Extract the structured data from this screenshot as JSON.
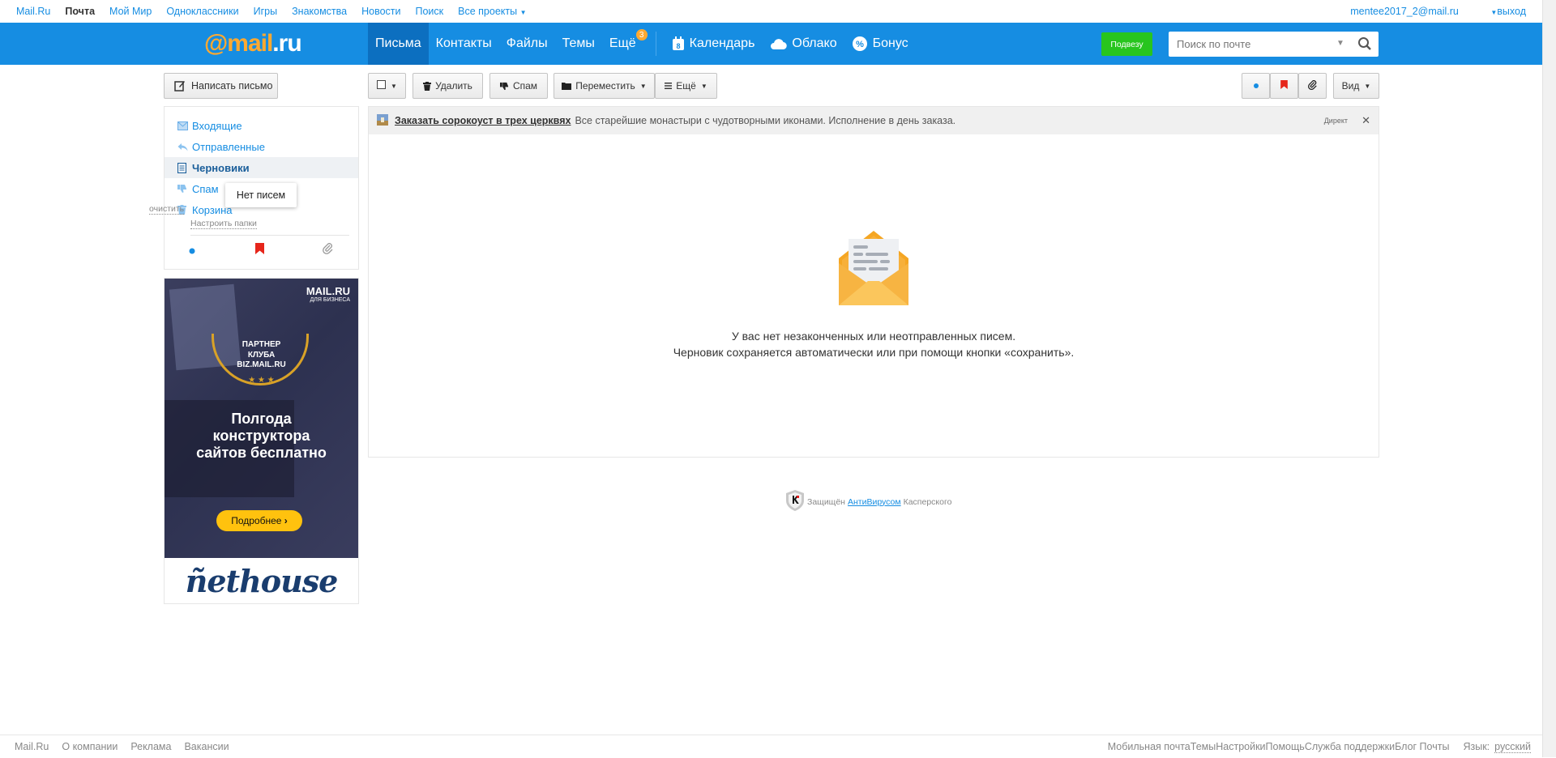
{
  "portal": {
    "links": [
      "Mail.Ru",
      "Почта",
      "Мой Мир",
      "Одноклассники",
      "Игры",
      "Знакомства",
      "Новости",
      "Поиск",
      "Все проекты"
    ],
    "user": "mentee2017_2@mail.ru",
    "logout": "выход"
  },
  "header": {
    "logo_at": "@",
    "logo_mail": "mail",
    "logo_dot": ".",
    "logo_ru": "ru",
    "nav": [
      "Письма",
      "Контакты",
      "Файлы",
      "Темы",
      "Ещё"
    ],
    "more_badge": "3",
    "calendar": "Календарь",
    "calendar_day": "8",
    "cloud": "Облако",
    "bonus": "Бонус",
    "podvezu": "Подвезу",
    "search_placeholder": "Поиск по почте"
  },
  "sidebar": {
    "compose": "Написать письмо",
    "folders": [
      "Входящие",
      "Отправленные",
      "Черновики",
      "Спам",
      "Корзина"
    ],
    "clear": "очистить",
    "setup": "Настроить папки",
    "tooltip": "Нет писем"
  },
  "ad_banner": {
    "brand": "MAIL.RU",
    "brand_sub": "ДЛЯ БИЗНЕСА",
    "partner_lines": [
      "ПАРТНЕР",
      "КЛУБА",
      "BIZ.MAIL.RU"
    ],
    "stars": "★ ★ ★",
    "headline_lines": [
      "Полгода",
      "конструктора",
      "сайтов бесплатно"
    ],
    "button": "Подробнее",
    "footer_logo": "ñethouse"
  },
  "toolbar": {
    "delete": "Удалить",
    "spam": "Спам",
    "move": "Переместить",
    "more": "Ещё",
    "view": "Вид"
  },
  "content": {
    "ad_title": "Заказать сорокоуст в трех церквях",
    "ad_text": "Все старейшие монастыри с чудотворными иконами. Исполнение в день заказа.",
    "ad_direct": "Директ",
    "empty_line1": "У вас нет незаконченных или неотправленных писем.",
    "empty_line2": "Черновик сохраняется автоматически или при помощи кнопки «сохранить».",
    "kasp_prefix": "Защищён",
    "kasp_link": "АнтиВирусом",
    "kasp_suffix": "Касперского"
  },
  "footer": {
    "left": [
      "Mail.Ru",
      "О компании",
      "Реклама",
      "Вакансии"
    ],
    "right": [
      "Мобильная почта",
      "Темы",
      "Настройки",
      "Помощь",
      "Служба поддержки",
      "Блог Почты"
    ],
    "lang_label": "Язык:",
    "lang_value": "русский"
  },
  "colors": {
    "brand_blue": "#168de2",
    "active_nav": "#0c6fc0",
    "accent_orange": "#ffa930",
    "podvezu_green": "#28c51e"
  }
}
